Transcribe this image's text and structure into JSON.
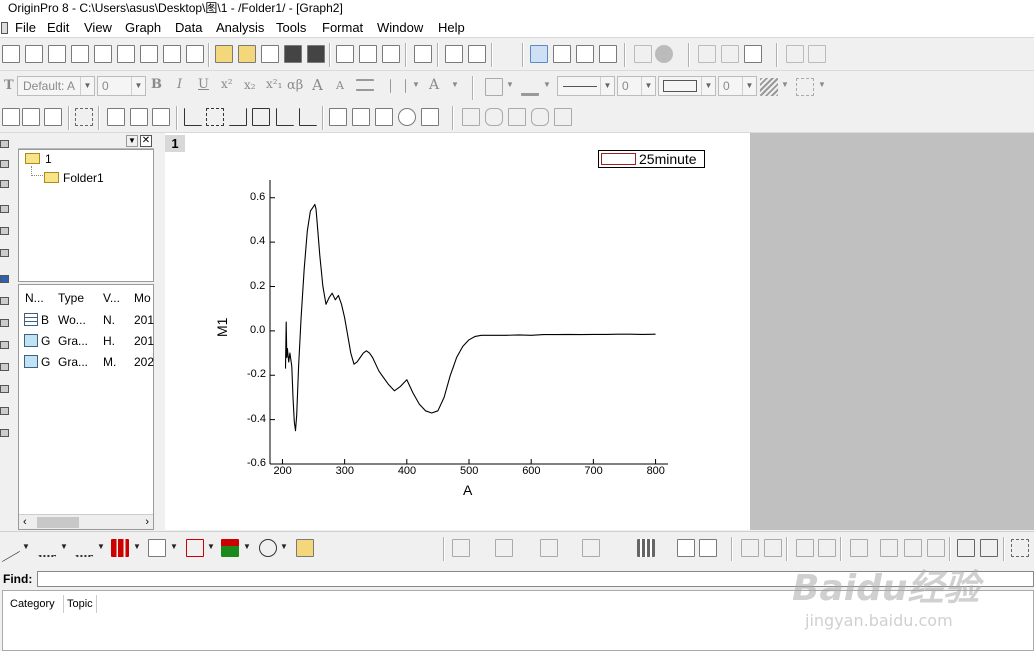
{
  "window": {
    "title": "OriginPro 8 - C:\\Users\\asus\\Desktop\\图\\1 - /Folder1/ - [Graph2]"
  },
  "menu": [
    "File",
    "Edit",
    "View",
    "Graph",
    "Data",
    "Analysis",
    "Tools",
    "Format",
    "Window",
    "Help"
  ],
  "format_toolbar": {
    "font_icon": "T",
    "font_name": "Default: A",
    "font_size": "0",
    "bold": "B",
    "italic": "I",
    "underline": "U",
    "superscript": "x²",
    "subscript": "x₂",
    "supersub": "x²₁",
    "greek": "αβ",
    "grow_font": "A",
    "shrink_font": "A",
    "font_color": "A",
    "line_width": "0",
    "border_width": "0"
  },
  "project_explorer": {
    "tree": {
      "root": "1",
      "child": "Folder1"
    },
    "columns": [
      "N...",
      "Type",
      "V...",
      "Mo"
    ],
    "rows": [
      {
        "name": "B",
        "type": "Wo...",
        "view": "N.",
        "modified": "201",
        "icon": "worksheet-icon"
      },
      {
        "name": "G",
        "type": "Gra...",
        "view": "H.",
        "modified": "201",
        "icon": "graph-icon"
      },
      {
        "name": "G",
        "type": "Gra...",
        "view": "M.",
        "modified": "202",
        "icon": "graph-icon"
      }
    ]
  },
  "graph": {
    "page_number": "1",
    "legend": "25minute",
    "x_axis_title": "A",
    "y_axis_title": "M1",
    "x_ticks": [
      "200",
      "300",
      "400",
      "500",
      "600",
      "700",
      "800"
    ],
    "y_ticks": [
      "0.6",
      "0.4",
      "0.2",
      "0.0",
      "-0.2",
      "-0.4",
      "-0.6"
    ]
  },
  "chart_data": {
    "type": "line",
    "title": "",
    "xlabel": "A",
    "ylabel": "M1",
    "xlim": [
      180,
      820
    ],
    "ylim": [
      -0.6,
      0.68
    ],
    "series": [
      {
        "name": "25minute",
        "color": "#000000",
        "x": [
          205,
          206,
          207,
          208,
          210,
          212,
          215,
          217,
          219,
          221,
          223,
          226,
          230,
          235,
          240,
          245,
          250,
          252,
          254,
          256,
          260,
          265,
          270,
          275,
          280,
          285,
          290,
          295,
          300,
          305,
          310,
          315,
          320,
          325,
          330,
          335,
          340,
          345,
          350,
          355,
          360,
          370,
          380,
          390,
          400,
          410,
          420,
          430,
          440,
          450,
          460,
          470,
          475,
          480,
          490,
          500,
          510,
          520,
          530,
          540,
          560,
          580,
          600,
          620,
          640,
          660,
          680,
          700,
          720,
          740,
          760,
          780,
          800
        ],
        "y": [
          -0.17,
          0.04,
          -0.12,
          -0.08,
          -0.14,
          -0.1,
          -0.16,
          -0.3,
          -0.41,
          -0.45,
          -0.38,
          -0.16,
          0.06,
          0.28,
          0.45,
          0.54,
          0.56,
          0.57,
          0.55,
          0.48,
          0.34,
          0.2,
          0.12,
          0.15,
          0.17,
          0.14,
          0.16,
          0.12,
          0.06,
          -0.02,
          -0.1,
          -0.15,
          -0.14,
          -0.12,
          -0.1,
          -0.09,
          -0.1,
          -0.12,
          -0.15,
          -0.18,
          -0.2,
          -0.24,
          -0.27,
          -0.25,
          -0.22,
          -0.28,
          -0.33,
          -0.36,
          -0.37,
          -0.36,
          -0.3,
          -0.2,
          -0.16,
          -0.12,
          -0.07,
          -0.04,
          -0.025,
          -0.02,
          -0.02,
          -0.02,
          -0.02,
          -0.018,
          -0.02,
          -0.017,
          -0.017,
          -0.016,
          -0.017,
          -0.016,
          -0.016,
          -0.015,
          -0.015,
          -0.016,
          -0.015
        ]
      }
    ]
  },
  "bottom_panel": {
    "find_label": "Find:",
    "tabs": [
      "Category",
      "Topic"
    ]
  },
  "watermark": {
    "brand": "Baidu经验",
    "url": "jingyan.baidu.com"
  }
}
